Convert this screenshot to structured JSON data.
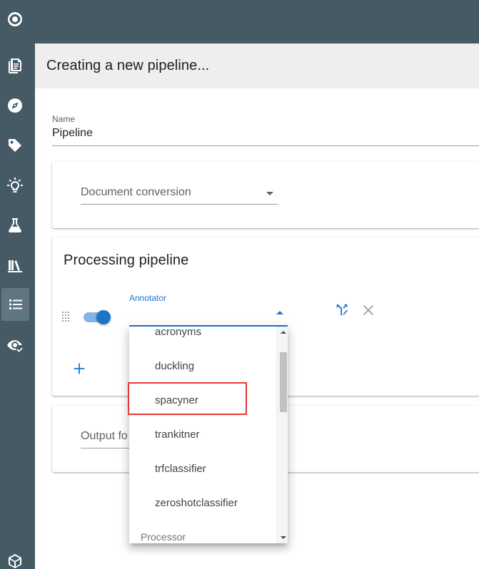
{
  "header": {
    "title": "Creating a new pipeline..."
  },
  "name_field": {
    "label": "Name",
    "value": "Pipeline"
  },
  "document_conversion": {
    "placeholder": "Document conversion"
  },
  "processing_pipeline": {
    "title": "Processing pipeline",
    "annotator_label": "Annotator",
    "toggle_on": true
  },
  "output_format": {
    "placeholder_visible": "Output fo"
  },
  "dropdown": {
    "items": [
      "acronyms",
      "duckling",
      "spacyner",
      "trankitner",
      "trfclassifier",
      "zeroshotclassifier"
    ],
    "group_label": "Processor",
    "highlighted": "spacyner"
  },
  "sidebar": {
    "icons": [
      "eye-logo-icon",
      "document-icon",
      "compass-icon",
      "tag-icon",
      "lightbulb-icon",
      "flask-icon",
      "library-icon",
      "list-icon",
      "eye-check-icon",
      "cube-icon"
    ],
    "active": "list-icon"
  },
  "colors": {
    "sidebar": "#455a64",
    "accent": "#1976d2",
    "header_bg": "#eeeeee",
    "highlight": "#e53935"
  }
}
